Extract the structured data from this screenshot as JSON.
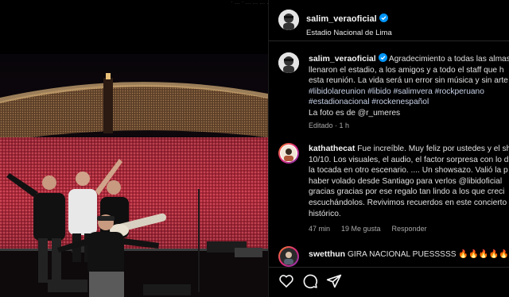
{
  "top_strip": "· ... · ... ... ... ...",
  "post": {
    "author": "salim_veraoficial",
    "location": "Estadio Nacional de Lima",
    "caption_lines": [
      "Agradecimiento a todas las almas",
      "llenaron el estadio, a los amigos y a todo el staff que h",
      "esta reunión. La vida será un error sin música y sin arte"
    ],
    "hashtag_lines": [
      "#libidolareunion #libido #salimvera #rockperuano",
      "#estadionacional #rockenespañol"
    ],
    "photo_credit": "La foto es de @r_umeres",
    "edited_meta": "Editado · 1 h"
  },
  "comments": [
    {
      "author": "kathathecat",
      "lines": [
        "Fue increíble. Muy feliz por ustedes y el sh",
        "10/10. Los visuales, el audio, el factor sorpresa con lo d",
        "la tocada en otro escenario. .... Un showsazo. Valió la p",
        "haber volado desde Santiago para verlos @libidoficial",
        "gracias gracias por ese regalo tan lindo a los que creci",
        "escuchándolos. Revivimos recuerdos en este concierto",
        "histórico."
      ],
      "time": "47 min",
      "likes": "19 Me gusta",
      "reply": "Responder"
    },
    {
      "author": "swetthun",
      "lines": [
        "GIRA NACIONAL PUESSSSS 🔥🔥🔥🔥🔥🔥"
      ]
    }
  ],
  "actions": {
    "like_icon": "heart-icon",
    "comment_icon": "comment-icon",
    "share_icon": "share-icon"
  },
  "colors": {
    "verified": "#0095f6",
    "background": "#000000",
    "text": "#f5f5f5",
    "meta": "#a8a8a8"
  }
}
